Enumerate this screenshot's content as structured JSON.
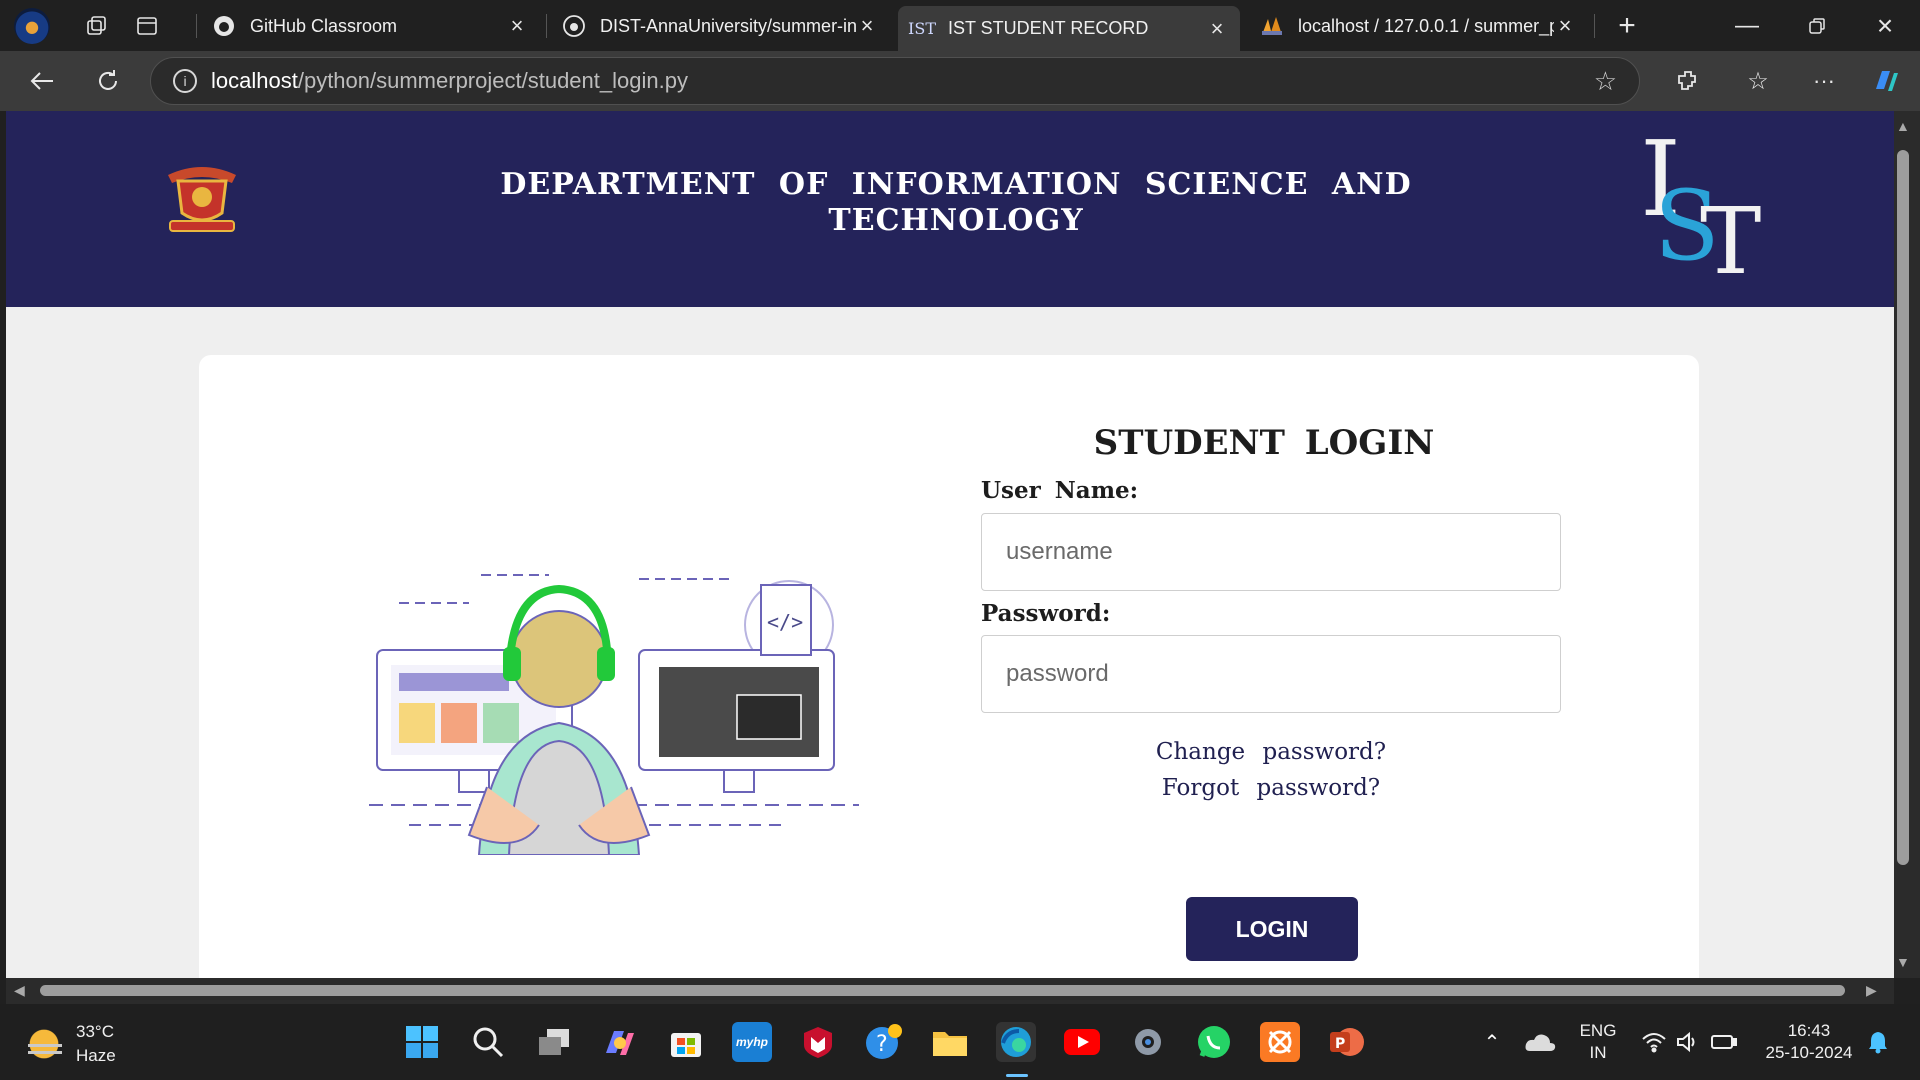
{
  "browser": {
    "tabs": [
      {
        "title": "GitHub Classroom",
        "icon": "github-icon"
      },
      {
        "title": "DIST-AnnaUniversity/summer-in",
        "icon": "github-icon"
      },
      {
        "title": "IST STUDENT RECORD",
        "icon": "ist-favicon",
        "active": true
      },
      {
        "title": "localhost / 127.0.0.1 / summer_p",
        "icon": "phpmyadmin-icon"
      }
    ],
    "url_host": "localhost",
    "url_path": "/python/summerproject/student_login.py"
  },
  "page": {
    "department_title": "DEPARTMENT OF INFORMATION SCIENCE AND TECHNOLOGY",
    "logo_text": "IST",
    "login_title": "STUDENT LOGIN",
    "username_label": "User Name:",
    "username_placeholder": "username",
    "password_label": "Password:",
    "password_placeholder": "password",
    "change_password_link": "Change password?",
    "forgot_password_link": "Forgot password?",
    "login_button": "LOGIN"
  },
  "taskbar": {
    "weather_temp": "33°C",
    "weather_desc": "Haze",
    "language_line1": "ENG",
    "language_line2": "IN",
    "time": "16:43",
    "date": "25-10-2024"
  },
  "colors": {
    "banner": "#24235a",
    "page_bg": "#efefef",
    "accent_green": "#22c93a"
  }
}
